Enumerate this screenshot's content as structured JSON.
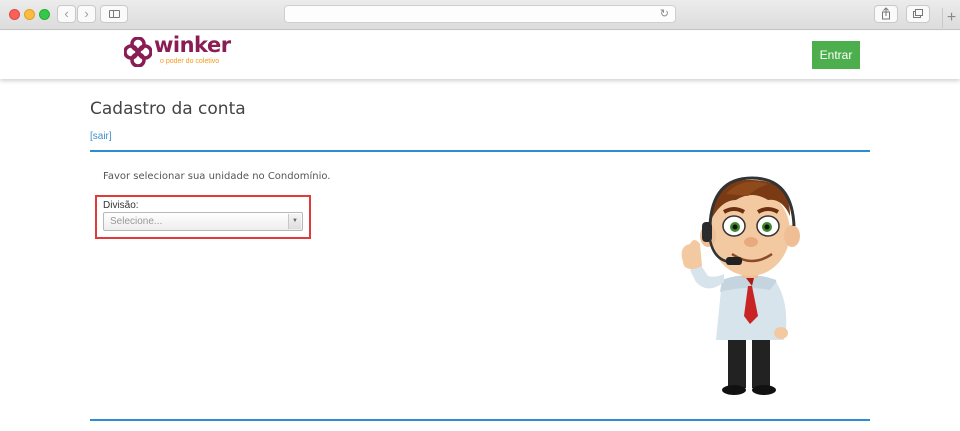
{
  "browser": {
    "url": "",
    "icons": {
      "close": "red-dot",
      "minimize": "yellow-dot",
      "maximize": "green-dot",
      "back": "chevron-left-icon",
      "forward": "chevron-right-icon",
      "sidebar": "sidebar-icon",
      "reload": "reload-icon",
      "share": "share-icon",
      "tabs": "tabs-icon",
      "new_tab": "plus-icon"
    }
  },
  "header": {
    "logo_word": "winker",
    "logo_tagline": "o poder do coletivo",
    "login_label": "Entrar"
  },
  "main": {
    "title": "Cadastro da conta",
    "logout_link": "[sair]",
    "instruction": "Favor selecionar sua unidade no Condomínio.",
    "division_label": "Divisão:",
    "division_select_value": "Selecione..."
  },
  "colors": {
    "accent_blue": "#2e8ccf",
    "button_green": "#4cae4c",
    "logo_purple": "#8a1e54",
    "logo_orange": "#f39a1f",
    "highlight_red": "#e03a3a"
  }
}
